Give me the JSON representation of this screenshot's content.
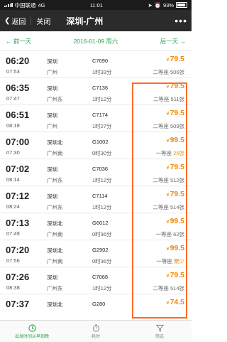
{
  "status": {
    "carrier": "中国联通",
    "network": "4G",
    "time": "11:01",
    "battery": "93%"
  },
  "nav": {
    "back": "返回",
    "close": "关闭",
    "title": "深圳-广州",
    "more": "•••"
  },
  "datebar": {
    "prev": "← 前一天",
    "date": "2016-01-09 周六",
    "next": "后一天 →"
  },
  "trains": [
    {
      "dep": "06:20",
      "arr": "07:53",
      "from": "深圳",
      "to": "广州",
      "no": "C7090",
      "dur": "1时33分",
      "price": "79.5",
      "seat": "二等座",
      "count": "506张",
      "low": false
    },
    {
      "dep": "06:35",
      "arr": "07:47",
      "from": "深圳",
      "to": "广州东",
      "no": "C7136",
      "dur": "1时12分",
      "price": "79.5",
      "seat": "二等座",
      "count": "511张",
      "low": false
    },
    {
      "dep": "06:51",
      "arr": "08:18",
      "from": "深圳",
      "to": "广州",
      "no": "C7174",
      "dur": "1时27分",
      "price": "79.5",
      "seat": "二等座",
      "count": "509张",
      "low": false
    },
    {
      "dep": "07:00",
      "arr": "07:30",
      "from": "深圳北",
      "to": "广州南",
      "no": "G1002",
      "dur": "0时30分",
      "price": "99.5",
      "seat": "一等座",
      "count": "25张",
      "low": true
    },
    {
      "dep": "07:02",
      "arr": "08:14",
      "from": "深圳",
      "to": "广州东",
      "no": "C7036",
      "dur": "1时12分",
      "price": "79.5",
      "seat": "二等座",
      "count": "512张",
      "low": false
    },
    {
      "dep": "07:12",
      "arr": "08:24",
      "from": "深圳",
      "to": "广州东",
      "no": "C7114",
      "dur": "1时12分",
      "price": "79.5",
      "seat": "二等座",
      "count": "514张",
      "low": false
    },
    {
      "dep": "07:13",
      "arr": "07:49",
      "from": "深圳北",
      "to": "广州南",
      "no": "G6012",
      "dur": "0时36分",
      "price": "99.5",
      "seat": "一等座",
      "count": "62张",
      "low": false
    },
    {
      "dep": "07:20",
      "arr": "07:56",
      "from": "深圳北",
      "to": "广州南",
      "no": "G2902",
      "dur": "0时36分",
      "price": "99.5",
      "seat": "一等座",
      "count": "票少",
      "low": true
    },
    {
      "dep": "07:26",
      "arr": "08:38",
      "from": "深圳",
      "to": "广州东",
      "no": "C7068",
      "dur": "1时12分",
      "price": "79.5",
      "seat": "二等座",
      "count": "514张",
      "low": false
    },
    {
      "dep": "07:37",
      "arr": "",
      "from": "深圳北",
      "to": "",
      "no": "G280",
      "dur": "",
      "price": "74.5",
      "seat": "",
      "count": "",
      "low": false
    }
  ],
  "currency": "¥",
  "tabs": [
    {
      "label": "出发时间从早到晚",
      "icon": "clock-icon",
      "active": true
    },
    {
      "label": "耗时",
      "icon": "timer-icon",
      "active": false
    },
    {
      "label": "筛选",
      "icon": "filter-icon",
      "active": false
    }
  ],
  "colors": {
    "accent": "#2aa64a",
    "price": "#f08a00",
    "highlight": "#ff6a28"
  }
}
